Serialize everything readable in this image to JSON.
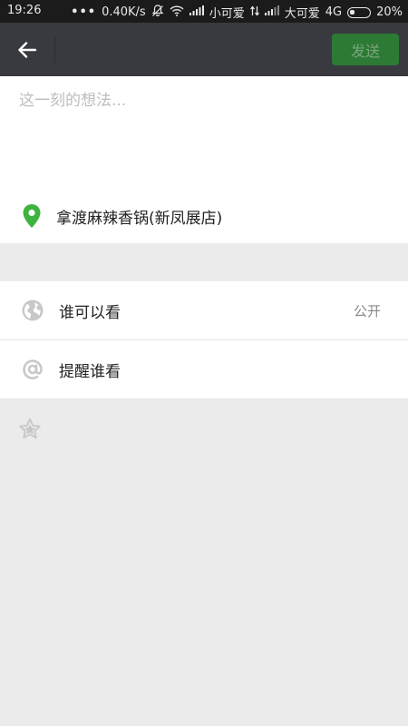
{
  "status_bar": {
    "time": "19:26",
    "dots": "•••",
    "speed": "0.40K/s",
    "carrier1": "小可爱",
    "carrier2": "大可爱",
    "network": "4G",
    "battery": "20%"
  },
  "top_bar": {
    "back_icon": "arrow-left-icon",
    "send_label": "发送",
    "send_color": "#2d7a35"
  },
  "compose": {
    "placeholder": "这一刻的想法...",
    "location": "拿渡麻辣香锅(新凤展店)",
    "location_icon_color": "#3fb33f"
  },
  "settings": {
    "visibility_label": "谁可以看",
    "visibility_value": "公开",
    "remind_label": "提醒谁看"
  },
  "icons": {
    "globe": "globe-icon",
    "at": "at-icon",
    "star": "star-icon",
    "location": "location-pin-icon"
  }
}
